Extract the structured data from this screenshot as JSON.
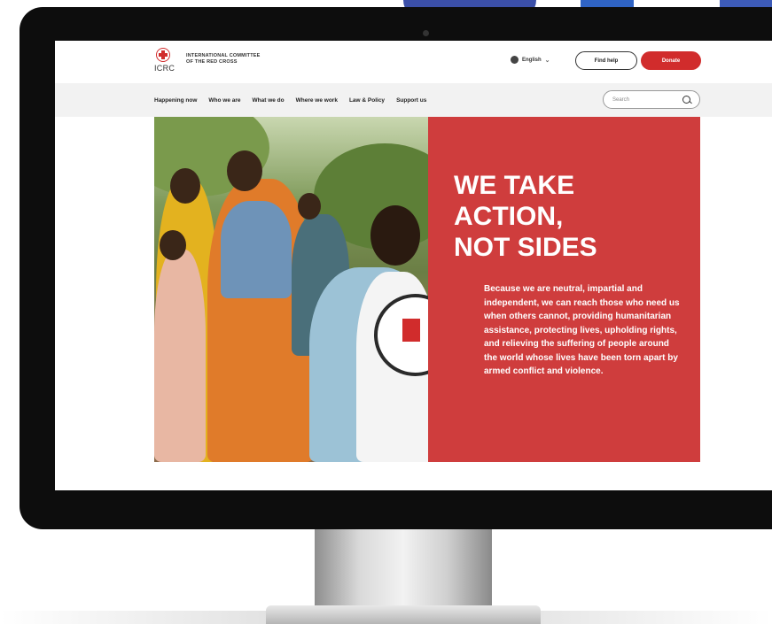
{
  "header": {
    "logo_abbr": "ICRC",
    "org_name_line1": "INTERNATIONAL COMMITTEE",
    "org_name_line2": "OF THE RED CROSS",
    "language": "English",
    "find_help_label": "Find help",
    "donate_label": "Donate"
  },
  "nav": {
    "items": [
      {
        "label": "Happening now"
      },
      {
        "label": "Who we are"
      },
      {
        "label": "What we do"
      },
      {
        "label": "Where we work"
      },
      {
        "label": "Law & Policy"
      },
      {
        "label": "Support us"
      }
    ],
    "search_placeholder": "Search"
  },
  "hero": {
    "title_line1": "WE TAKE",
    "title_line2": "ACTION,",
    "title_line3": "NOT SIDES",
    "body": "Because we are neutral, impartial and independent, we can reach those who need us when others cannot, providing humanitarian assistance, protecting lives, upholding rights, and relieving the suffering of people around the world whose lives have been torn apart by armed conflict and violence."
  },
  "colors": {
    "brand_red": "#cf3d3d",
    "donate_red": "#d12c2c",
    "monitor_bezel": "#0d0d0d"
  },
  "icons": [
    "red-cross-logo-icon",
    "globe-icon",
    "chevron-down-icon",
    "search-icon"
  ]
}
